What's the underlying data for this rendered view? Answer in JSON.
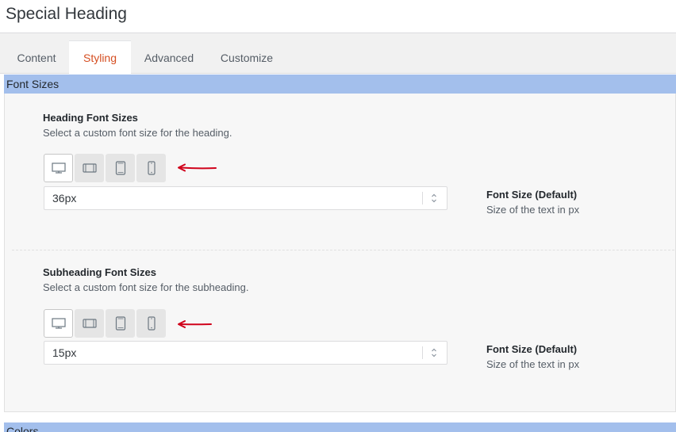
{
  "header": {
    "title": "Special Heading"
  },
  "tabs": [
    {
      "label": "Content",
      "active": false
    },
    {
      "label": "Styling",
      "active": true
    },
    {
      "label": "Advanced",
      "active": false
    },
    {
      "label": "Customize",
      "active": false
    }
  ],
  "sections": {
    "font_sizes": {
      "header": "Font Sizes"
    },
    "colors": {
      "header": "Colors"
    }
  },
  "heading_sizes": {
    "title": "Heading Font Sizes",
    "description": "Select a custom font size for the heading.",
    "value": "36px",
    "aside_title": "Font Size (Default)",
    "aside_description": "Size of the text in px"
  },
  "subheading_sizes": {
    "title": "Subheading Font Sizes",
    "description": "Select a custom font size for the subheading.",
    "value": "15px",
    "aside_title": "Font Size (Default)",
    "aside_description": "Size of the text in px"
  },
  "devices": [
    "desktop-icon",
    "laptop-icon",
    "tablet-icon",
    "mobile-icon"
  ],
  "colors": {
    "accent": "#d54e21",
    "section_header": "#a3bfec",
    "arrow": "#d0021b"
  }
}
